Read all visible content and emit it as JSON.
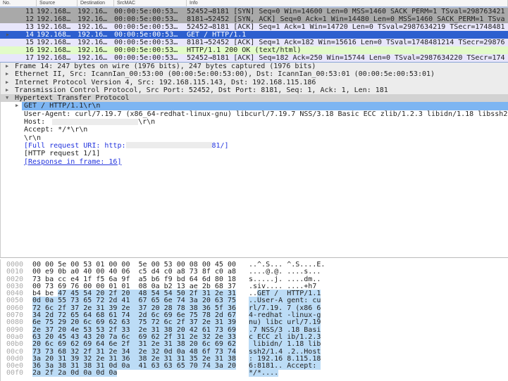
{
  "packet_list": {
    "columns": [
      "No.",
      "Source",
      "Destination",
      "SrcMAC",
      "Info"
    ],
    "rows": [
      {
        "no": "11",
        "src": "192.168…",
        "dst": "192.16…",
        "mac": "00:00:5e:00:53…",
        "info": "52452→8181 [SYN] Seq=0 Win=14600 Len=0 MSS=1460 SACK_PERM=1 TSval=298763421",
        "bg": "#a9a9a9"
      },
      {
        "no": "12",
        "src": "192.168…",
        "dst": "192.16…",
        "mac": "00:00:5e:00:53…",
        "info": "8181→52452 [SYN, ACK] Seq=0 Ack=1 Win=14480 Len=0 MSS=1460 SACK_PERM=1 TSva",
        "bg": "#a9a9a9"
      },
      {
        "no": "13",
        "src": "192.168…",
        "dst": "192.16…",
        "mac": "00:00:5e:00:53…",
        "info": "52452→8181 [ACK] Seq=1 Ack=1 Win=14720 Len=0 TSval=2987634219 TSecr=1748481",
        "bg": "#e8e6fb"
      },
      {
        "no": "14",
        "src": "192.168…",
        "dst": "192.16…",
        "mac": "00:00:5e:00:53…",
        "info": "GET / HTTP/1.1",
        "bg": "#2d5fcf",
        "selected": true
      },
      {
        "no": "15",
        "src": "192.168…",
        "dst": "192.16…",
        "mac": "00:00:5e:00:53…",
        "info": "8181→52452 [ACK] Seq=1 Ack=182 Win=15616 Len=0 TSval=1748481214 TSecr=29876",
        "bg": "#e8e6fb"
      },
      {
        "no": "16",
        "src": "192.168…",
        "dst": "192.16…",
        "mac": "00:00:5e:00:53…",
        "info": "HTTP/1.1 200 OK  (text/html)",
        "bg": "#e2fbc8"
      },
      {
        "no": "17",
        "src": "192.168…",
        "dst": "192.16…",
        "mac": "00:00:5e:00:53…",
        "info": "52452→8181 [ACK] Seq=182 Ack=250 Win=15744 Len=0 TSval=2987634220 TSecr=174",
        "bg": "#e8e6fb"
      }
    ]
  },
  "details": {
    "frame": "Frame 14: 247 bytes on wire (1976 bits), 247 bytes captured (1976 bits)",
    "ethernet": "Ethernet II, Src: IcannIan_00:53:00 (00:00:5e:00:53:00), Dst: IcannIan_00:53:01 (00:00:5e:00:53:01)",
    "ip": "Internet Protocol Version 4, Src: 192.168.115.143, Dst: 192.168.115.186",
    "tcp": "Transmission Control Protocol, Src Port: 52452, Dst Port: 8181, Seq: 1, Ack: 1, Len: 181",
    "http": "Hypertext Transfer Protocol",
    "get": "GET / HTTP/1.1\\r\\n",
    "user_agent": "User-Agent: curl/7.19.7 (x86_64-redhat-linux-gnu) libcurl/7.19.7 NSS/3.18 Basic ECC zlib/1.2.3 libidn/1.18 libssh2",
    "host_label": "Host: ",
    "host_suffix": "\\r\\n",
    "accept": "Accept: */*\\r\\n",
    "crlf": "\\r\\n",
    "full_uri_prefix": "[Full request URI: http:",
    "full_uri_suffix": "81/]",
    "request_num": "[HTTP request 1/1]",
    "response_in": "[Response in frame: 16]"
  },
  "hex": [
    {
      "off": "0000",
      "b1": "00 00 5e 00 53 01 00 00",
      "b2": "5e 00 53 00 08 00 45 00",
      "a1": "..^.S...",
      "a2": "^.S....E.",
      "hl": 0
    },
    {
      "off": "0010",
      "b1": "00 e9 0b a0 40 00 40 06",
      "b2": "c5 d4 c0 a8 73 8f c0 a8",
      "a1": "....@.@.",
      "a2": "....s...",
      "hl": 0
    },
    {
      "off": "0020",
      "b1": "73 ba cc e4 1f f5 6a 9f",
      "b2": "a5 b6 f9 bd 64 6d 80 18",
      "a1": "s.....j.",
      "a2": "....dm..",
      "hl": 0
    },
    {
      "off": "0030",
      "b1": "00 73 69 76 00 00 01 01",
      "b2": "08 0a b2 13 ae 2b 68 37",
      "a1": ".siv....",
      "a2": "....+h7",
      "hl": 0
    },
    {
      "off": "0040",
      "b0": "b4 be ",
      "b1": "47 45 54 20 2f 20",
      "b2": "48 54 54 50 2f 31 2e 31",
      "a0": "..",
      "a1": "GET / ",
      "a2": "HTTP/1.1",
      "hl": 2
    },
    {
      "off": "0050",
      "b1": "0d 0a 55 73 65 72 2d 41",
      "b2": "67 65 6e 74 3a 20 63 75",
      "a1": "..User-A",
      "a2": "gent: cu",
      "hl": 1
    },
    {
      "off": "0060",
      "b1": "72 6c 2f 37 2e 31 39 2e",
      "b2": "37 20 28 78 38 36 5f 36",
      "a1": "rl/7.19.",
      "a2": "7 (x86_6",
      "hl": 1
    },
    {
      "off": "0070",
      "b1": "34 2d 72 65 64 68 61 74",
      "b2": "2d 6c 69 6e 75 78 2d 67",
      "a1": "4-redhat",
      "a2": "-linux-g",
      "hl": 1
    },
    {
      "off": "0080",
      "b1": "6e 75 29 20 6c 69 62 63",
      "b2": "75 72 6c 2f 37 2e 31 39",
      "a1": "nu) libc",
      "a2": "url/7.19",
      "hl": 1
    },
    {
      "off": "0090",
      "b1": "2e 37 20 4e 53 53 2f 33",
      "b2": "2e 31 38 20 42 61 73 69",
      "a1": ".7 NSS/3",
      "a2": ".18 Basi",
      "hl": 1
    },
    {
      "off": "00a0",
      "b1": "63 20 45 43 43 20 7a 6c",
      "b2": "69 62 2f 31 2e 32 2e 33",
      "a1": "c ECC zl",
      "a2": "ib/1.2.3",
      "hl": 1
    },
    {
      "off": "00b0",
      "b1": "20 6c 69 62 69 64 6e 2f",
      "b2": "31 2e 31 38 20 6c 69 62",
      "a1": " libidn/",
      "a2": "1.18 lib",
      "hl": 1
    },
    {
      "off": "00c0",
      "b1": "73 73 68 32 2f 31 2e 34",
      "b2": "2e 32 0d 0a 48 6f 73 74",
      "a1": "ssh2/1.4",
      "a2": ".2..Host",
      "hl": 1
    },
    {
      "off": "00d0",
      "b1": "3a 20 31 39 32 2e 31 36",
      "b2": "38 2e 31 31 35 2e 31 38",
      "a1": ": 192.16",
      "a2": "8.115.18",
      "hl": 1
    },
    {
      "off": "00e0",
      "b1": "36 3a 38 31 38 31 0d 0a",
      "b2": "41 63 63 65 70 74 3a 20",
      "a1": "6:8181..",
      "a2": "Accept: ",
      "hl": 1
    },
    {
      "off": "00f0",
      "b1": "2a 2f 2a 0d 0a 0d 0a",
      "b2": "",
      "a1": "*/*....",
      "a2": "",
      "hl": 1
    }
  ]
}
